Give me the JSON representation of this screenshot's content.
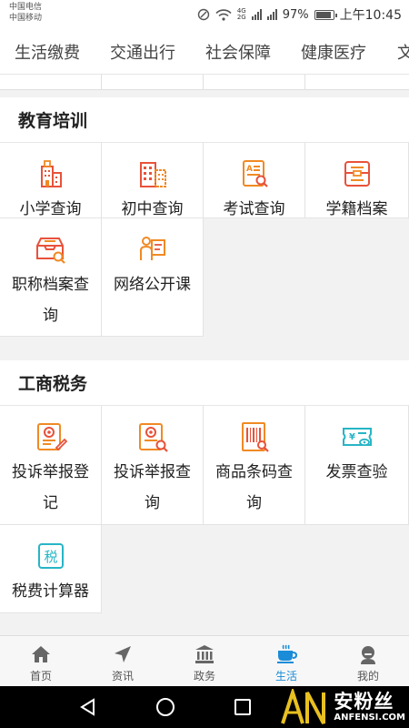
{
  "status_bar": {
    "carrier_1": "中国电信",
    "carrier_2": "中国移动",
    "network_1": "4G",
    "network_2": "2G",
    "battery": "97%",
    "time": "上午10:45"
  },
  "top_tabs": [
    "生活缴费",
    "交通出行",
    "社会保障",
    "健康医疗",
    "文"
  ],
  "sections": [
    {
      "title": "教育培训",
      "items": [
        {
          "label": "小学查询",
          "icon": "school-building-icon"
        },
        {
          "label": "初中查询",
          "icon": "middle-school-building-icon"
        },
        {
          "label": "考试查询",
          "icon": "exam-search-icon"
        },
        {
          "label": "学籍档案",
          "icon": "student-record-icon"
        },
        {
          "label": "职称档案查询",
          "icon": "archive-tray-search-icon"
        },
        {
          "label": "网络公开课",
          "icon": "online-class-icon"
        }
      ]
    },
    {
      "title": "工商税务",
      "items": [
        {
          "label": "投诉举报登记",
          "icon": "complaint-register-icon"
        },
        {
          "label": "投诉举报查询",
          "icon": "complaint-search-icon"
        },
        {
          "label": "商品条码查询",
          "icon": "barcode-search-icon"
        },
        {
          "label": "发票查验",
          "icon": "invoice-check-icon"
        },
        {
          "label": "税费计算器",
          "icon": "tax-calculator-icon"
        }
      ]
    }
  ],
  "bottom_nav": [
    {
      "label": "首页",
      "icon": "home-icon"
    },
    {
      "label": "资讯",
      "icon": "navigation-arrow-icon"
    },
    {
      "label": "政务",
      "icon": "government-building-icon"
    },
    {
      "label": "生活",
      "icon": "coffee-cup-icon",
      "active": true
    },
    {
      "label": "我的",
      "icon": "user-profile-icon"
    }
  ],
  "watermark": {
    "cn": "安粉丝",
    "en": "ANFENSI.COM",
    "logo": "AN"
  },
  "colors": {
    "orange": "#f08a24",
    "red": "#e8523a",
    "teal": "#27b5c6",
    "active_blue": "#1a8cd8"
  }
}
